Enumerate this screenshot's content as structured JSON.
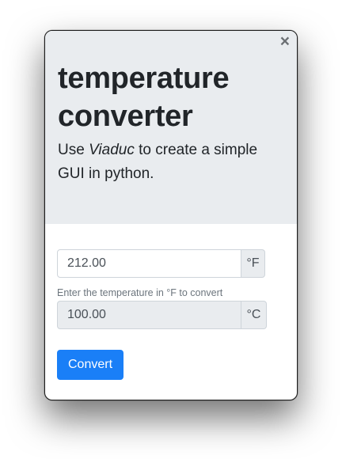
{
  "window": {
    "close_glyph": "×"
  },
  "header": {
    "title": "temperature converter",
    "lead_prefix": "Use ",
    "lead_emphasis": "Viaduc",
    "lead_suffix": " to create a simple GUI in python."
  },
  "form": {
    "fahrenheit_value": "212.00",
    "fahrenheit_unit": "°F",
    "help_text": "Enter the temperature in °F to convert",
    "celsius_value": "100.00",
    "celsius_unit": "°C",
    "convert_label": "Convert"
  },
  "colors": {
    "primary": "#1a7ff7",
    "jumbotron_bg": "#e9ecef",
    "text": "#212529"
  },
  "icons": {
    "close": "close-icon"
  }
}
